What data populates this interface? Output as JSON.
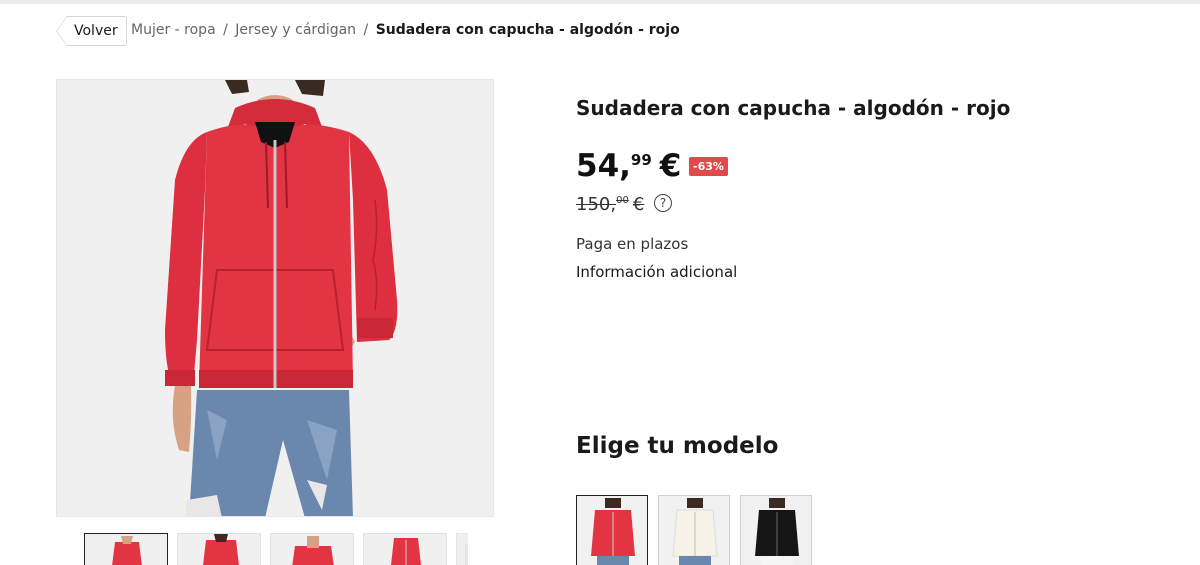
{
  "breadcrumb": {
    "back_label": "Volver",
    "items": [
      "Mujer - ropa",
      "Jersey y cárdigan"
    ],
    "separator": "/",
    "current": "Sudadera con capucha - algodón - rojo"
  },
  "product": {
    "title": "Sudadera con capucha - algodón - rojo",
    "price": {
      "integer": "54,",
      "decimals": "99",
      "currency": "€"
    },
    "discount_badge": "-63%",
    "old_price": {
      "integer": "150,",
      "decimals": "00",
      "currency": "€"
    },
    "help_icon": "?",
    "installments_label": "Paga en plazos",
    "additional_info_label": "Información adicional"
  },
  "models": {
    "heading": "Elige tu modelo",
    "options": [
      {
        "color": "red",
        "selected": true
      },
      {
        "color": "cream",
        "selected": false
      },
      {
        "color": "black",
        "selected": false
      }
    ]
  },
  "gallery": {
    "thumbnail_count": 5,
    "selected_index": 0
  },
  "colors": {
    "badge": "#e04a4a",
    "hoodie_red": "#e33444",
    "jeans": "#6a87ad"
  }
}
